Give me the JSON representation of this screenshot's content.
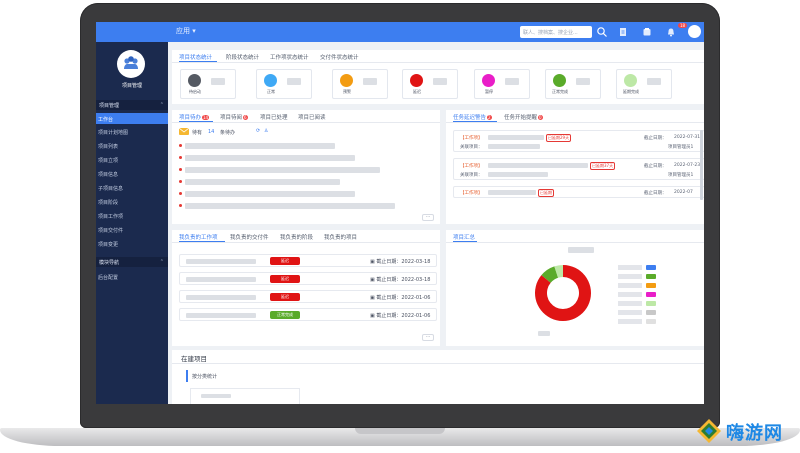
{
  "topbar": {
    "app_menu": "应用 ▾",
    "search_placeholder": "联人、搜档案、搜企业...",
    "notification_count": "18"
  },
  "sidebar": {
    "logo_label": "项目管理",
    "groups": [
      {
        "label": "项目管理"
      },
      {
        "label": "模块导航"
      }
    ],
    "items": [
      {
        "label": "工作台"
      },
      {
        "label": "项目计划地图"
      },
      {
        "label": "项目列表"
      },
      {
        "label": "项目立项"
      },
      {
        "label": "项目信息"
      },
      {
        "label": "子项目信息"
      },
      {
        "label": "项目阶段"
      },
      {
        "label": "项目工作项"
      },
      {
        "label": "项目交付件"
      },
      {
        "label": "项目变更"
      },
      {
        "label": "后台配置"
      }
    ]
  },
  "status_panel": {
    "tabs": [
      "项目状态统计",
      "阶段状态统计",
      "工作项状态统计",
      "交付件状态统计"
    ],
    "statuses": [
      {
        "label": "待启动",
        "color": "#555a63"
      },
      {
        "label": "正常",
        "color": "#3fa9f5"
      },
      {
        "label": "预警",
        "color": "#f39c12"
      },
      {
        "label": "延迟",
        "color": "#e01414"
      },
      {
        "label": "暂停",
        "color": "#e91ec8"
      },
      {
        "label": "正常完成",
        "color": "#5aab2a"
      },
      {
        "label": "延期完成",
        "color": "#bde8a6"
      }
    ]
  },
  "todo_panel": {
    "tabs": [
      {
        "label": "项目待办",
        "badge": "14"
      },
      {
        "label": "项目待阅",
        "badge": "6"
      },
      {
        "label": "项目已处理",
        "badge": ""
      },
      {
        "label": "项目已阅读",
        "badge": ""
      }
    ],
    "summary_prefix": "待有",
    "summary_count": "14",
    "summary_suffix": "条待办",
    "more": "···"
  },
  "warning_panel": {
    "tabs": [
      {
        "label": "任务延迟警告",
        "badge": "2"
      },
      {
        "label": "任务开始提醒",
        "badge": "0"
      }
    ],
    "tasks": [
      {
        "tag": "【工作项】",
        "delay": "已延期29天",
        "deadline_label": "截止日期：",
        "deadline": "2022-07-31",
        "field": "关联项目：",
        "owner": "项目管理员1"
      },
      {
        "tag": "【工作项】",
        "delay": "已延期37天",
        "deadline_label": "截止日期：",
        "deadline": "2022-07-23",
        "field": "关联项目：",
        "owner": "项目管理员1"
      },
      {
        "tag": "【工作项】",
        "delay": "已延期",
        "deadline_label": "截止日期：",
        "deadline": "2022-07",
        "field": "",
        "owner": ""
      }
    ]
  },
  "responsible_panel": {
    "tabs": [
      "我负责的工作项",
      "我负责的交付件",
      "我负责的阶段",
      "我负责的项目"
    ],
    "rows": [
      {
        "status": "延迟",
        "status_color": "#e01414",
        "date_label": "截止日期：",
        "date": "2022-03-18"
      },
      {
        "status": "延迟",
        "status_color": "#e01414",
        "date_label": "截止日期：",
        "date": "2022-03-18"
      },
      {
        "status": "延迟",
        "status_color": "#e01414",
        "date_label": "截止日期：",
        "date": "2022-01-06"
      },
      {
        "status": "正常完成",
        "status_color": "#5aab2a",
        "date_label": "截止日期：",
        "date": "2022-01-06"
      }
    ],
    "more": "···"
  },
  "summary_panel": {
    "tab": "项目汇总",
    "legend_colors": [
      "#3d7ef0",
      "#5aab2a",
      "#f39c12",
      "#e91ec8",
      "#bde8a6",
      "#c8c8c8",
      "#e0e0e0"
    ]
  },
  "building_panel": {
    "title": "在建项目",
    "subtitle": "按分类统计"
  },
  "chart_data": {
    "type": "pie",
    "slices": [
      {
        "value": 86,
        "color": "#e01414"
      },
      {
        "value": 9,
        "color": "#5aab2a"
      },
      {
        "value": 5,
        "color": "#bde8a6"
      }
    ],
    "donut": true
  },
  "watermark": {
    "text": "嗨游网"
  }
}
